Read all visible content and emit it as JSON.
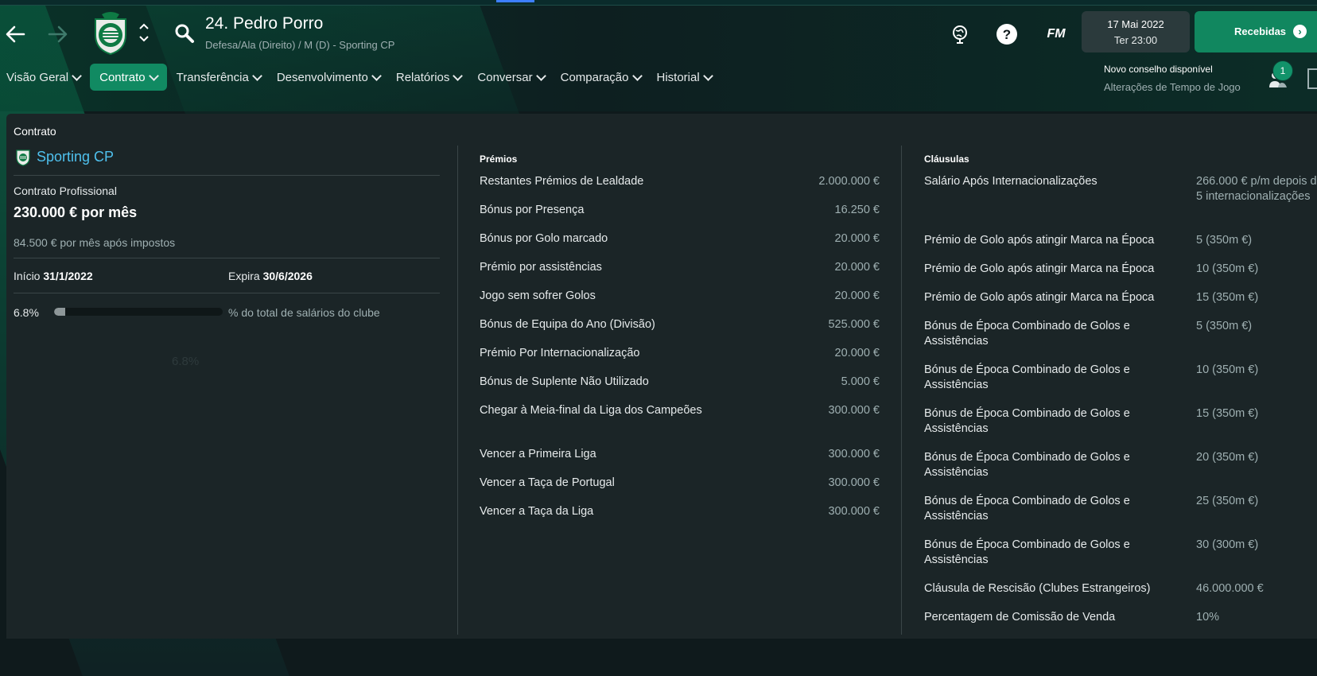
{
  "header": {
    "player_title": "24. Pedro Porro",
    "player_subtitle": "Defesa/Ala (Direito) / M (D) - Sporting CP",
    "fm_label": "FM",
    "date": "17 Mai 2022",
    "time": "Ter 23:00",
    "inbox_label": "Recebidas"
  },
  "tabs": [
    {
      "label": "Visão Geral"
    },
    {
      "label": "Contrato"
    },
    {
      "label": "Transferência"
    },
    {
      "label": "Desenvolvimento"
    },
    {
      "label": "Relatórios"
    },
    {
      "label": "Conversar"
    },
    {
      "label": "Comparação"
    },
    {
      "label": "Historial"
    }
  ],
  "advice": {
    "title": "Novo conselho disponível",
    "text": "Alterações de Tempo de Jogo",
    "badge": "1"
  },
  "contract": {
    "section_title": "Contrato",
    "club": "Sporting CP",
    "type": "Contrato Profissional",
    "wage": "230.000 € por mês",
    "after_tax": "84.500 € por mês após impostos",
    "start_label": "Início",
    "start_value": "31/1/2022",
    "expiry_label": "Expira",
    "expiry_value": "30/6/2026",
    "wage_share": "6.8%",
    "wage_share_fraction": 0.068,
    "wage_share_label": "% do total de salários do clube",
    "ghost": "6.8%"
  },
  "bonuses": {
    "title": "Prémios",
    "rows": [
      {
        "label": "Restantes Prémios de Lealdade",
        "value": "2.000.000 €"
      },
      {
        "label": "Bónus por Presença",
        "value": "16.250 €"
      },
      {
        "label": "Bónus por Golo marcado",
        "value": "20.000 €"
      },
      {
        "label": "Prémio por assistências",
        "value": "20.000 €"
      },
      {
        "label": "Jogo sem sofrer Golos",
        "value": "20.000 €"
      },
      {
        "label": "Bónus de Equipa do Ano (Divisão)",
        "value": "525.000 €"
      },
      {
        "label": "Prémio Por Internacionalização",
        "value": "20.000 €"
      },
      {
        "label": "Bónus de Suplente Não Utilizado",
        "value": "5.000 €"
      },
      {
        "label": "Chegar à Meia-final da Liga dos Campeões",
        "value": "300.000 €"
      },
      {
        "label": "Vencer a Primeira Liga",
        "value": "300.000 €"
      },
      {
        "label": "Vencer a Taça de Portugal",
        "value": "300.000 €"
      },
      {
        "label": "Vencer a Taça da Liga",
        "value": "300.000 €"
      }
    ]
  },
  "clauses": {
    "title": "Cláusulas",
    "rows": [
      {
        "label": "Salário Após Internacionalizações",
        "value": "266.000 € p/m depois de 5 internacionalizações"
      },
      {
        "label": "Prémio de Golo após atingir Marca na Época",
        "value": "5 (350m €)"
      },
      {
        "label": "Prémio de Golo após atingir Marca na Época",
        "value": "10 (350m €)"
      },
      {
        "label": "Prémio de Golo após atingir Marca na Época",
        "value": "15 (350m €)"
      },
      {
        "label": "Bónus de Época Combinado de Golos e Assistências",
        "value": "5 (350m €)"
      },
      {
        "label": "Bónus de Época Combinado de Golos e Assistências",
        "value": "10 (350m €)"
      },
      {
        "label": "Bónus de Época Combinado de Golos e Assistências",
        "value": "15 (350m €)"
      },
      {
        "label": "Bónus de Época Combinado de Golos e Assistências",
        "value": "20 (350m €)"
      },
      {
        "label": "Bónus de Época Combinado de Golos e Assistências",
        "value": "25 (350m €)"
      },
      {
        "label": "Bónus de Época Combinado de Golos e Assistências",
        "value": "30 (300m €)"
      },
      {
        "label": "Cláusula de Rescisão (Clubes Estrangeiros)",
        "value": "46.000.000 €"
      },
      {
        "label": "Percentagem de Comissão de Venda",
        "value": "10%"
      }
    ]
  }
}
